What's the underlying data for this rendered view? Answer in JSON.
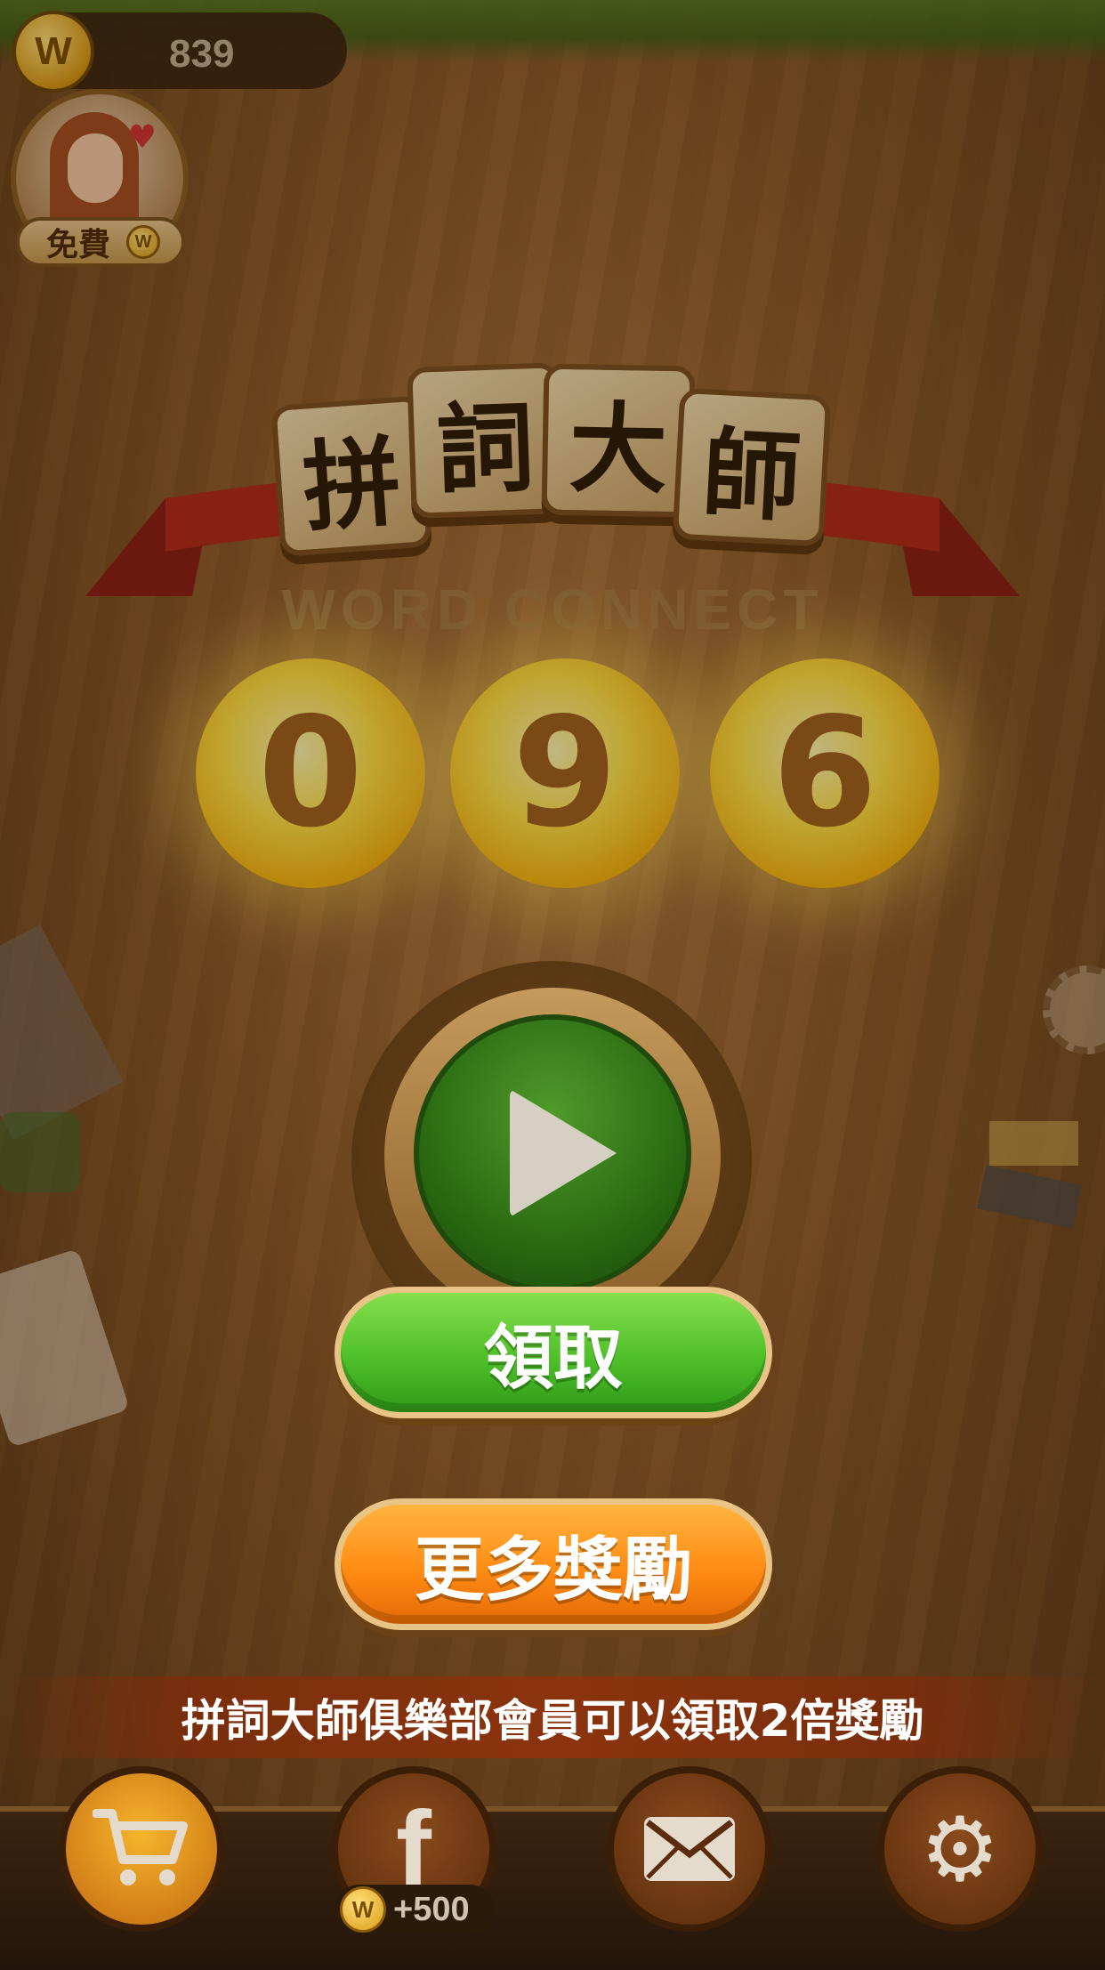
{
  "header": {
    "coin_symbol": "W",
    "coin_balance": "839"
  },
  "free_offer": {
    "label": "免費",
    "coin_symbol": "W"
  },
  "logo": {
    "tiles": [
      "拼",
      "詞",
      "大",
      "師"
    ],
    "subtitle": "WORD CONNECT"
  },
  "countdown": {
    "digits": [
      "0",
      "9",
      "6"
    ]
  },
  "buttons": {
    "collect_label": "領取",
    "more_rewards_label": "更多獎勵"
  },
  "banner": {
    "text": "拼詞大師俱樂部會員可以領取2倍獎勵"
  },
  "bottom_nav": {
    "items": [
      {
        "name": "shop",
        "icon": "cart-icon"
      },
      {
        "name": "facebook",
        "icon": "facebook-icon",
        "reward": "+500",
        "coin_symbol": "W"
      },
      {
        "name": "mail",
        "icon": "mail-icon"
      },
      {
        "name": "settings",
        "icon": "gear-icon"
      }
    ]
  },
  "colors": {
    "collect_button": "#4fbf2a",
    "more_rewards_button": "#ff8c14",
    "play_button": "#2a6a12",
    "ball": "#ffe044"
  }
}
